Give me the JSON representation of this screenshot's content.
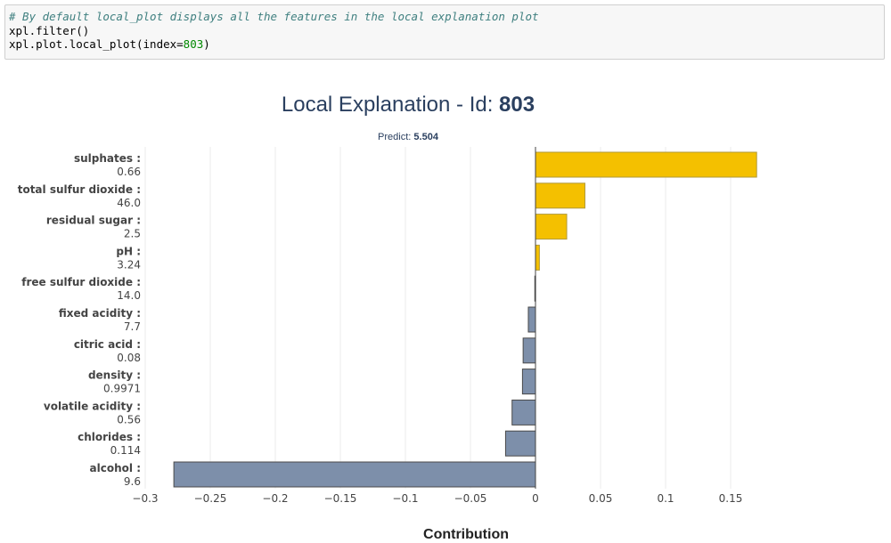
{
  "code_cell": {
    "comment": "# By default local_plot displays all the features in the local explanation plot",
    "line2": "xpl.filter()",
    "line3_prefix": "xpl.plot.local_plot(index=",
    "line3_number": "803",
    "line3_suffix": ")"
  },
  "chart_data": {
    "type": "bar",
    "orientation": "horizontal",
    "title_prefix": "Local Explanation - Id: ",
    "title_id": "803",
    "subtitle_prefix": "Predict: ",
    "subtitle_value": "5.504",
    "xlabel": "Contribution",
    "ylabel": "",
    "xlim": [
      -0.3,
      0.17
    ],
    "xticks": [
      -0.3,
      -0.25,
      -0.2,
      -0.15,
      -0.1,
      -0.05,
      0,
      0.05,
      0.1,
      0.15
    ],
    "xtick_labels": [
      "−0.3",
      "−0.25",
      "−0.2",
      "−0.15",
      "−0.1",
      "−0.05",
      "0",
      "0.05",
      "0.1",
      "0.15"
    ],
    "grid": true,
    "positive_color": "#f4c000",
    "negative_color": "#7d8faa",
    "categories": [
      {
        "feature": "sulphates :",
        "value_label": "0.66",
        "contribution": 0.17
      },
      {
        "feature": "total sulfur dioxide :",
        "value_label": "46.0",
        "contribution": 0.038
      },
      {
        "feature": "residual sugar :",
        "value_label": "2.5",
        "contribution": 0.024
      },
      {
        "feature": "pH :",
        "value_label": "3.24",
        "contribution": 0.003
      },
      {
        "feature": "free sulfur dioxide :",
        "value_label": "14.0",
        "contribution": -0.0005
      },
      {
        "feature": "fixed acidity :",
        "value_label": "7.7",
        "contribution": -0.0055
      },
      {
        "feature": "citric acid :",
        "value_label": "0.08",
        "contribution": -0.0095
      },
      {
        "feature": "density :",
        "value_label": "0.9971",
        "contribution": -0.01
      },
      {
        "feature": "volatile acidity :",
        "value_label": "0.56",
        "contribution": -0.018
      },
      {
        "feature": "chlorides :",
        "value_label": "0.114",
        "contribution": -0.023
      },
      {
        "feature": "alcohol :",
        "value_label": "9.6",
        "contribution": -0.278
      }
    ]
  }
}
